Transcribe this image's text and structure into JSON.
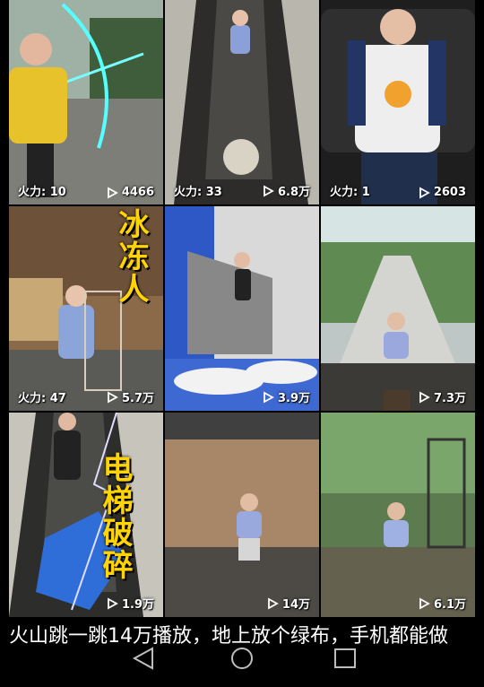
{
  "tiles": [
    {
      "left_label": "火力: 10",
      "views": "4466",
      "art": ""
    },
    {
      "left_label": "火力: 33",
      "views": "6.8万",
      "art": ""
    },
    {
      "left_label": "火力: 1",
      "views": "2603",
      "art": ""
    },
    {
      "left_label": "火力: 47",
      "views": "5.7万",
      "art": "冰冻人"
    },
    {
      "left_label": "",
      "views": "3.9万",
      "art": ""
    },
    {
      "left_label": "",
      "views": "7.3万",
      "art": ""
    },
    {
      "left_label": "",
      "views": "1.9万",
      "art": "电梯破碎"
    },
    {
      "left_label": "",
      "views": "14万",
      "art": ""
    },
    {
      "left_label": "",
      "views": "6.1万",
      "art": ""
    }
  ],
  "caption": "火山跳一跳14万播放，地上放个绿布，手机都能做",
  "navbar": {
    "back": "back-triangle-icon",
    "home": "home-circle-icon",
    "recents": "recents-square-icon"
  },
  "colors": {
    "accent": "#ffd400",
    "play": "#ffffff"
  }
}
